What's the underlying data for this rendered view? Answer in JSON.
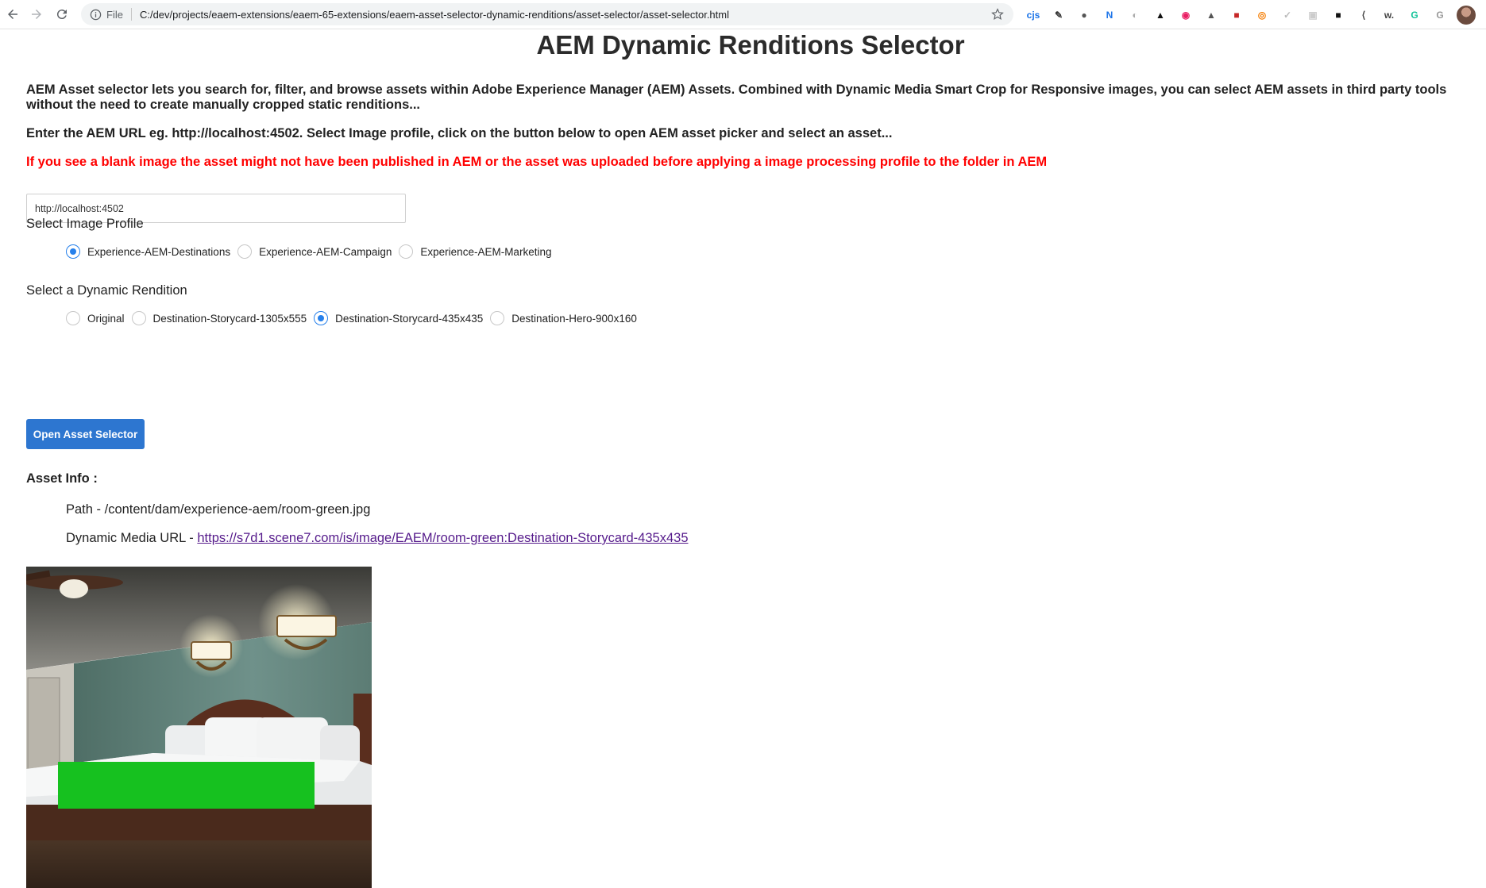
{
  "browser": {
    "scheme_label": "File",
    "url": "C:/dev/projects/eaem-extensions/eaem-65-extensions/eaem-asset-selector-dynamic-renditions/asset-selector/asset-selector.html",
    "extensions": [
      {
        "name": "cjs-extension",
        "glyph": "cjs",
        "color": "#1a73e8"
      },
      {
        "name": "pen-extension",
        "glyph": "✎",
        "color": "#333"
      },
      {
        "name": "circle-extension",
        "glyph": "●",
        "color": "#555"
      },
      {
        "name": "n-extension",
        "glyph": "N",
        "color": "#1a73e8"
      },
      {
        "name": "ghost-extension",
        "glyph": "◐",
        "color": "#aaa"
      },
      {
        "name": "grad-extension",
        "glyph": "▲",
        "color": "#111"
      },
      {
        "name": "pink-circle-extension",
        "glyph": "◉",
        "color": "#e91e63"
      },
      {
        "name": "triangle-extension",
        "glyph": "▲",
        "color": "#555"
      },
      {
        "name": "red-square-extension",
        "glyph": "■",
        "color": "#c62828"
      },
      {
        "name": "orange-ring-extension",
        "glyph": "◎",
        "color": "#f57c00"
      },
      {
        "name": "check-extension",
        "glyph": "✓",
        "color": "#bbb"
      },
      {
        "name": "box-extension",
        "glyph": "▣",
        "color": "#ccc"
      },
      {
        "name": "mask-extension",
        "glyph": "■",
        "color": "#111"
      },
      {
        "name": "k-extension",
        "glyph": "⟨",
        "color": "#444"
      },
      {
        "name": "w-extension",
        "glyph": "w.",
        "color": "#444"
      },
      {
        "name": "grammarly-extension",
        "glyph": "G",
        "color": "#15c39a"
      },
      {
        "name": "g-extension",
        "glyph": "G",
        "color": "#999"
      }
    ]
  },
  "page": {
    "title": "AEM Dynamic Renditions Selector",
    "intro": "AEM Asset selector lets you search for, filter, and browse assets within Adobe Experience Manager (AEM) Assets. Combined with Dynamic Media Smart Crop for Responsive images, you can select AEM assets in third party tools without the need to create manually cropped static renditions...",
    "instruction": "Enter the AEM URL eg. http://localhost:4502. Select Image profile, click on the button below to open AEM asset picker and select an asset...",
    "warning": "If you see a blank image the asset might not have been published in AEM or the asset was uploaded before applying a image processing profile to the folder in AEM",
    "warning_color": "#ff0000",
    "aem_url_value": "http://localhost:4502"
  },
  "image_profile": {
    "label": "Select Image Profile",
    "options": [
      {
        "label": "Experience-AEM-Destinations",
        "checked": true
      },
      {
        "label": "Experience-AEM-Campaign",
        "checked": false
      },
      {
        "label": "Experience-AEM-Marketing",
        "checked": false
      }
    ]
  },
  "dynamic_rendition": {
    "label": "Select a Dynamic Rendition",
    "options": [
      {
        "label": "Original",
        "checked": false
      },
      {
        "label": "Destination-Storycard-1305x555",
        "checked": false
      },
      {
        "label": "Destination-Storycard-435x435",
        "checked": true
      },
      {
        "label": "Destination-Hero-900x160",
        "checked": false
      }
    ]
  },
  "actions": {
    "open_selector_label": "Open Asset Selector",
    "button_color": "#2d76d0"
  },
  "asset_info": {
    "heading": "Asset Info :",
    "path_prefix": "Path - ",
    "path": "/content/dam/experience-aem/room-green.jpg",
    "dm_prefix": "Dynamic Media URL - ",
    "dm_url": "https://s7d1.scene7.com/is/image/EAEM/room-green:Destination-Storycard-435x435"
  },
  "preview": {
    "accent_block_color": "#16c11f"
  }
}
